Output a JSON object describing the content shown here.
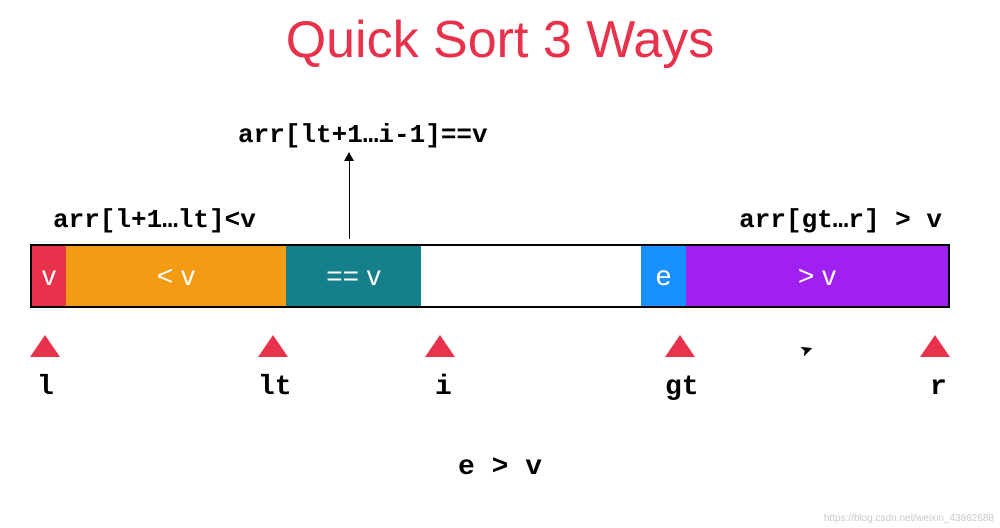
{
  "title": "Quick Sort 3 Ways",
  "labels": {
    "lt_range": "arr[l+1…lt]<v",
    "eq_range": "arr[lt+1…i-1]==v",
    "gt_range": "arr[gt…r] > v"
  },
  "segments": {
    "v": "v",
    "lt": "< v",
    "eq": "== v",
    "gap": "",
    "e": "e",
    "gt": "> v"
  },
  "pointers": {
    "l": "l",
    "lt": "lt",
    "i": "i",
    "gt": "gt",
    "r": "r"
  },
  "bottom_condition": "e > v",
  "watermark": "https://blog.csdn.net/weixin_43862688",
  "colors": {
    "title": "#e8314a",
    "pivot": "#e8314a",
    "lt": "#f39b13",
    "eq": "#16808a",
    "e": "#1990ff",
    "gt": "#a020f0",
    "pointer": "#e8314a"
  }
}
